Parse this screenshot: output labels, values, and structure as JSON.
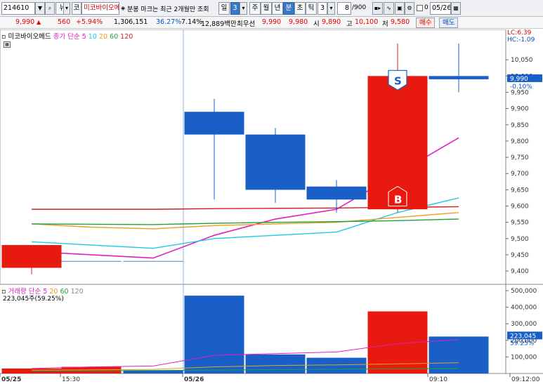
{
  "toolbar": {
    "code": "214610",
    "news": "뉴",
    "market": "코",
    "stock_name": "미코바이오메",
    "notice": "분봉 마크는 최근 2개월만 조회",
    "period_tabs": [
      "일",
      "3",
      "주",
      "월",
      "년",
      "분",
      "초",
      "틱"
    ],
    "active_tab": "분",
    "interval_value": "3",
    "count_value": "8",
    "count_total": "/900",
    "check_label": "0",
    "date_value": "05/26"
  },
  "quote": {
    "price": "9,990",
    "change": "560",
    "change_pct": "+5.94%",
    "volume": "1,306,151",
    "ratio1": "36.27%",
    "ratio2": "7.14%",
    "amount": "12,889백만",
    "best_label": "최우선",
    "best_ask": "9,990",
    "best_bid": "9,980",
    "open_label": "시",
    "open": "9,890",
    "high_label": "고",
    "high": "10,100",
    "low_label": "저",
    "low": "9,580",
    "buy_button": "매수",
    "sell_button": "매도"
  },
  "legend": {
    "name": "미코바이오메드",
    "ma_label": "종가 단순",
    "ma_periods": [
      "5",
      "10",
      "20",
      "60",
      "120"
    ],
    "lc_label": "LC:6.39",
    "hc_label": "HC:-1.09",
    "vol_label": "거래량",
    "vol_ma_label": "단순",
    "vol_ma_periods": [
      "5",
      "20",
      "60",
      "120"
    ],
    "vol_value": "223,045주(59.25%)"
  },
  "colors": {
    "up": "#e8190f",
    "down": "#1a5fc8",
    "ma5": "#e020c0",
    "ma10": "#20c8e8",
    "ma20": "#e8a020",
    "ma60": "#20a040",
    "ma120": "#d02020"
  },
  "chart_data": {
    "type": "candlestick",
    "price_axis": {
      "ticks": [
        "10,050",
        "10,000",
        "9,950",
        "9,900",
        "9,850",
        "9,800",
        "9,750",
        "9,700",
        "9,650",
        "9,600",
        "9,550",
        "9,500",
        "9,450",
        "9,400"
      ],
      "range": [
        9370,
        10100
      ]
    },
    "volume_axis": {
      "ticks": [
        "500,000",
        "400,000",
        "300,000",
        "200,000",
        "100,000"
      ],
      "range": [
        0,
        530000
      ]
    },
    "time_labels": [
      "05/25",
      "15:30",
      "05/26",
      "09:10",
      "09:12:00"
    ],
    "candles": [
      {
        "o": 9480,
        "h": 9480,
        "l": 9390,
        "c": 9410,
        "v": 30000,
        "dir": "up"
      },
      {
        "o": 9430,
        "h": 9430,
        "l": 9430,
        "c": 9430,
        "v": 40000,
        "dir": "up"
      },
      {
        "o": 9430,
        "h": 9430,
        "l": 9430,
        "c": 9430,
        "v": 20000,
        "dir": "down"
      },
      {
        "o": 9890,
        "h": 9930,
        "l": 9620,
        "c": 9820,
        "v": 470000,
        "dir": "down"
      },
      {
        "o": 9820,
        "h": 9840,
        "l": 9610,
        "c": 9650,
        "v": 115000,
        "dir": "down"
      },
      {
        "o": 9660,
        "h": 9680,
        "l": 9580,
        "c": 9620,
        "v": 95000,
        "dir": "down"
      },
      {
        "o": 9590,
        "h": 10100,
        "l": 9580,
        "c": 10000,
        "v": 375000,
        "dir": "up"
      },
      {
        "o": 10000,
        "h": 10100,
        "l": 9950,
        "c": 9990,
        "v": 223045,
        "dir": "down"
      }
    ],
    "ma_series": [
      {
        "name": "5",
        "values": [
          9460,
          9450,
          9440,
          9510,
          9560,
          9590,
          9700,
          9810
        ]
      },
      {
        "name": "10",
        "values": [
          9490,
          9480,
          9470,
          9500,
          9510,
          9520,
          9580,
          9625
        ]
      },
      {
        "name": "20",
        "values": [
          9545,
          9535,
          9530,
          9540,
          9545,
          9550,
          9565,
          9580
        ]
      },
      {
        "name": "60",
        "values": [
          9545,
          9544,
          9543,
          9547,
          9550,
          9552,
          9555,
          9560
        ]
      },
      {
        "name": "120",
        "values": [
          9590,
          9590,
          9590,
          9592,
          9593,
          9594,
          9596,
          9598
        ]
      }
    ],
    "price_marker": "9,990",
    "price_marker_pct": "-0.10%",
    "vol_marker": "223,045",
    "vol_marker_pct": "59.25%",
    "signals": [
      {
        "label": "S",
        "index": 6,
        "price": 10000
      },
      {
        "label": "B",
        "index": 6,
        "price": 9600
      }
    ]
  }
}
